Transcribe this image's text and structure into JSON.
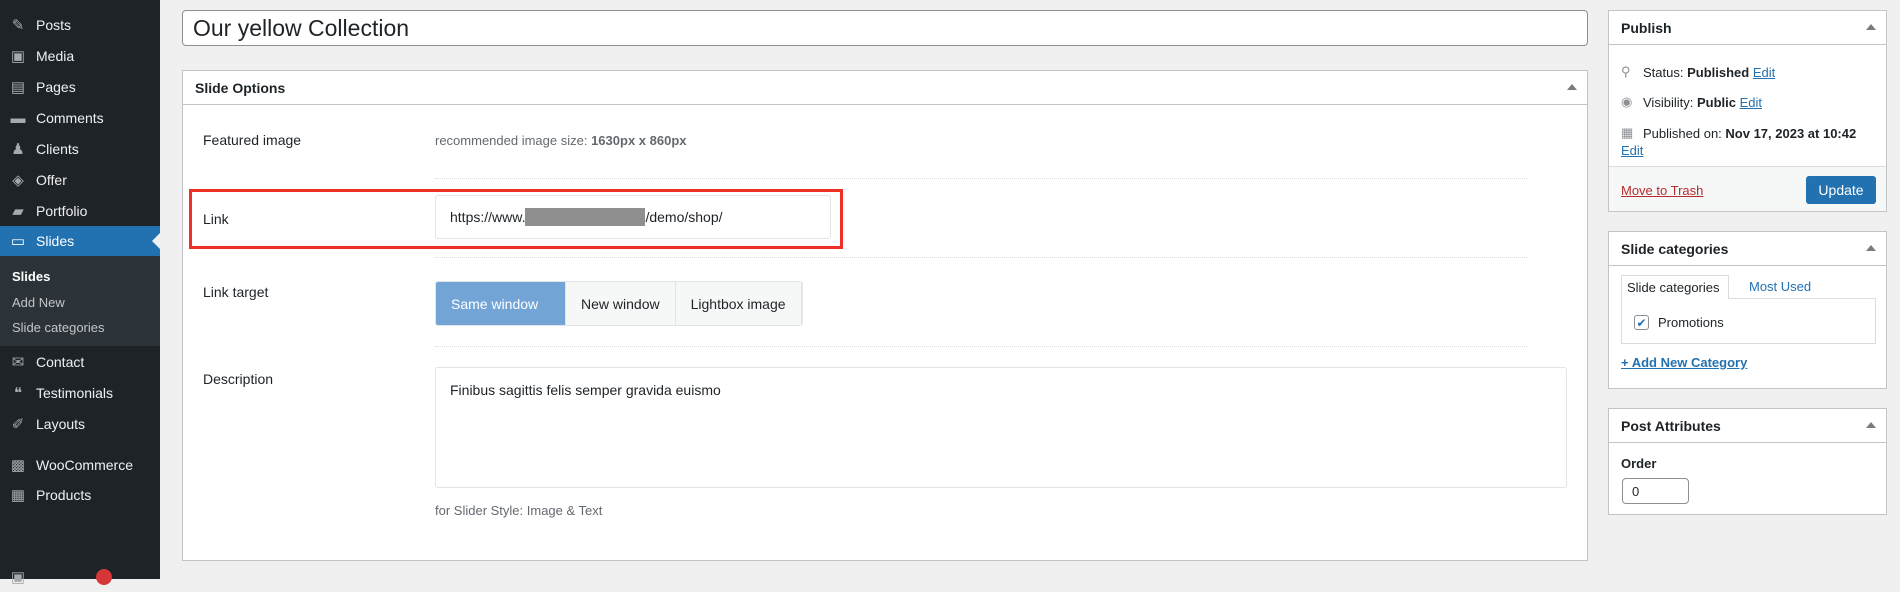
{
  "sidebar": {
    "items": [
      {
        "label": "Posts",
        "icon": "pin-icon"
      },
      {
        "label": "Media",
        "icon": "media-icon"
      },
      {
        "label": "Pages",
        "icon": "pages-icon"
      },
      {
        "label": "Comments",
        "icon": "comment-icon"
      },
      {
        "label": "Clients",
        "icon": "user-icon"
      },
      {
        "label": "Offer",
        "icon": "tag-icon"
      },
      {
        "label": "Portfolio",
        "icon": "folder-icon"
      },
      {
        "label": "Slides",
        "icon": "slides-icon",
        "active": true
      },
      {
        "label": "Contact",
        "icon": "mail-icon"
      },
      {
        "label": "Testimonials",
        "icon": "quote-icon"
      },
      {
        "label": "Layouts",
        "icon": "pencil-icon"
      },
      {
        "label": "WooCommerce",
        "icon": "woo-icon"
      },
      {
        "label": "Products",
        "icon": "archive-icon"
      }
    ],
    "submenu": [
      "Slides",
      "Add New",
      "Slide categories"
    ]
  },
  "title": "Our yellow Collection",
  "slide_options": {
    "heading": "Slide Options",
    "featured_label": "Featured image",
    "featured_hint_prefix": "recommended image size: ",
    "featured_hint_size": "1630px x 860px",
    "link_label": "Link",
    "link_prefix": "https://www.",
    "link_suffix": "/demo/shop/",
    "target_label": "Link target",
    "targets": [
      "Same window",
      "New window",
      "Lightbox image"
    ],
    "target_selected": "Same window",
    "desc_label": "Description",
    "desc_value": "Finibus sagittis felis semper gravida euismo",
    "desc_hint": "for Slider Style: Image & Text"
  },
  "publish": {
    "heading": "Publish",
    "status_label": "Status: ",
    "status": "Published",
    "visibility_label": "Visibility: ",
    "visibility": "Public",
    "published_label": "Published on: ",
    "published": "Nov 17, 2023 at 10:42",
    "edit": "Edit",
    "trash": "Move to Trash",
    "update": "Update"
  },
  "categories": {
    "heading": "Slide categories",
    "tab_all": "Slide categories",
    "tab_used": "Most Used",
    "items": [
      {
        "label": "Promotions",
        "checked": true
      }
    ],
    "add": "+ Add New Category"
  },
  "attributes": {
    "heading": "Post Attributes",
    "order_label": "Order",
    "order_value": "0"
  },
  "colors": {
    "accent": "#2271b1",
    "sidebar": "#1d2327",
    "highlight": "#ee3124",
    "selected_segment": "#72a5d6"
  }
}
